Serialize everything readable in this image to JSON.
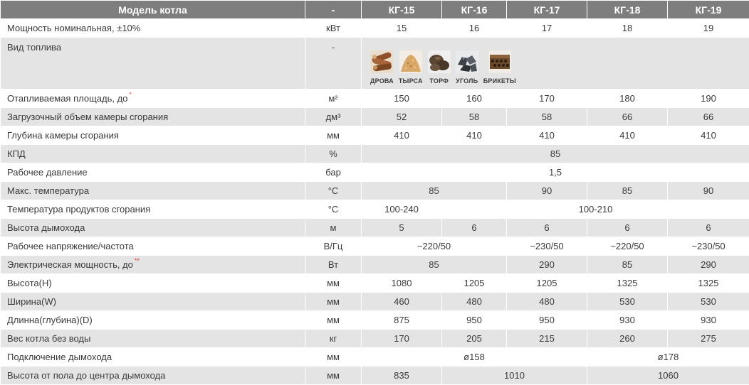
{
  "header": {
    "param": "Модель котла",
    "unit": "-",
    "models": [
      "КГ-15",
      "КГ-16",
      "КГ-17",
      "КГ-18",
      "КГ-19"
    ]
  },
  "power": {
    "label": "Мощность номинальная, ±10%",
    "unit": "кВт",
    "values": [
      "15",
      "16",
      "17",
      "18",
      "19"
    ]
  },
  "fuel": {
    "label": "Вид топлива",
    "unit": "-",
    "items": [
      {
        "label": "ДРОВА",
        "icon": "firewood-icon",
        "color": "#9a5a34"
      },
      {
        "label": "ТЫРСА",
        "icon": "sawdust-icon",
        "color": "#d6a465"
      },
      {
        "label": "ТОРФ",
        "icon": "peat-icon",
        "color": "#5b4634"
      },
      {
        "label": "УГОЛЬ",
        "icon": "coal-icon",
        "color": "#4c5057"
      },
      {
        "label": "БРИКЕТЫ",
        "icon": "briquettes-icon",
        "color": "#6b4a2c"
      }
    ]
  },
  "area": {
    "label": "Отапливаемая площадь, до",
    "mark": "*",
    "unit": "м²",
    "values": [
      "150",
      "160",
      "170",
      "180",
      "190"
    ]
  },
  "volume": {
    "label": "Загрузочный объем камеры сгорания",
    "unit": "дм³",
    "values": [
      "52",
      "58",
      "58",
      "66",
      "66"
    ]
  },
  "depth": {
    "label": "Глубина камеры сгорания",
    "unit": "мм",
    "values": [
      "410",
      "410",
      "410",
      "410",
      "410"
    ]
  },
  "efficiency": {
    "label": "КПД",
    "unit": "%",
    "value": "85"
  },
  "pressure": {
    "label": "Рабочее давление",
    "unit": "бар",
    "value": "1,5"
  },
  "max_temp": {
    "label": "Макс. температура",
    "unit": "°С",
    "v12": "85",
    "v3": "90",
    "v4": "85",
    "v5": "90"
  },
  "flue_temp": {
    "label": "Температура продуктов сгорания",
    "unit": "°С",
    "v1": "100-240",
    "v25": "100-210"
  },
  "chimney_height": {
    "label": "Высота дымохода",
    "unit": "м",
    "values": [
      "5",
      "6",
      "6",
      "6",
      "6"
    ]
  },
  "voltage": {
    "label": "Рабочее напряжение/частота",
    "unit": "В/Гц",
    "v12": "~220/50",
    "v3": "~230/50",
    "v4": "~220/50",
    "v5": "~230/50"
  },
  "el_power": {
    "label": "Электрическая мощность, до",
    "mark": "**",
    "unit": "Вт",
    "v12": "85",
    "v3": "290",
    "v4": "85",
    "v5": "290"
  },
  "height": {
    "label": "Высота(H)",
    "unit": "мм",
    "values": [
      "1080",
      "1205",
      "1205",
      "1325",
      "1325"
    ]
  },
  "width": {
    "label": "Ширина(W)",
    "unit": "мм",
    "values": [
      "460",
      "480",
      "480",
      "530",
      "530"
    ]
  },
  "length": {
    "label": "Длинна(глубина)(D)",
    "unit": "мм",
    "values": [
      "875",
      "950",
      "950",
      "930",
      "930"
    ]
  },
  "weight": {
    "label": "Вес котла без воды",
    "unit": "кг",
    "values": [
      "170",
      "205",
      "215",
      "260",
      "275"
    ]
  },
  "chimney_conn": {
    "label": "Подключение дымохода",
    "unit": "мм",
    "v13": "ø158",
    "v45": "ø178"
  },
  "chimney_center": {
    "label": "Высота от пола до центра дымохода",
    "unit": "мм",
    "v1": "835",
    "v23": "1010",
    "v45": "1060"
  }
}
